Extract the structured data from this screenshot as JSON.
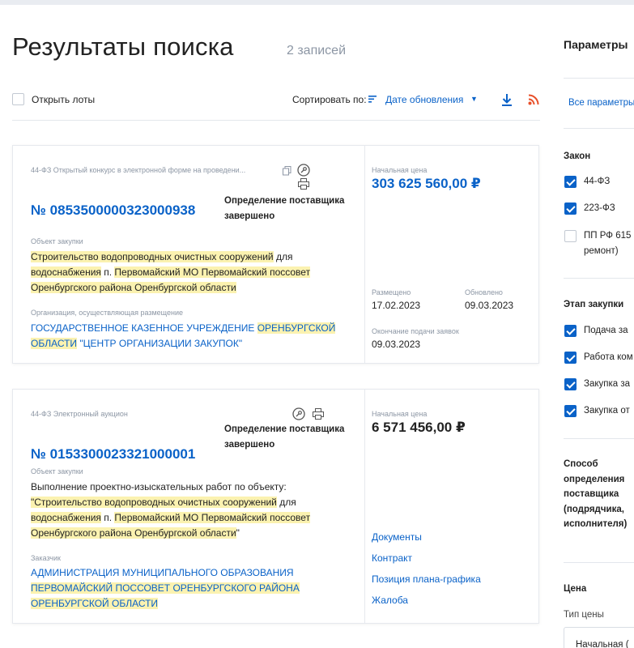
{
  "page": {
    "title": "Результаты поиска",
    "count": "2 записей"
  },
  "toolbar": {
    "open_lots_label": "Открыть лоты",
    "sort_label": "Сортировать по:",
    "sort_value": "Дате обновления",
    "icons": [
      "sort-lines-icon",
      "chevron-down-icon",
      "download-icon",
      "rss-icon"
    ]
  },
  "results": [
    {
      "law": "44-ФЗ Открытый конкурс в электронной форме на проведени...",
      "reg_number": "№ 0853500000323000938",
      "status": "Определение поставщика завершено",
      "object_label": "Объект закупки",
      "object_text": [
        {
          "t": "Строительство водопроводных очистных сооружений",
          "hl": true
        },
        {
          "t": " для ",
          "hl": false
        },
        {
          "t": "водоснабжения",
          "hl": true
        },
        {
          "t": " п. ",
          "hl": false
        },
        {
          "t": "Первомайский МО Первомайский поссовет Оренбургского района Оренбургской области",
          "hl": true
        }
      ],
      "org_label": "Организация, осуществляющая размещение",
      "org_text": [
        {
          "t": "ГОСУДАРСТВЕННОЕ КАЗЕННОЕ УЧРЕЖДЕНИЕ ",
          "hl": false
        },
        {
          "t": "ОРЕНБУРГСКОЙ ОБЛАСТИ",
          "hl": true
        },
        {
          "t": " \"ЦЕНТР ОРГАНИЗАЦИИ ЗАКУПОК\"",
          "hl": false
        }
      ],
      "price_label": "Начальная цена",
      "price": "303 625 560,00 ₽",
      "placed_label": "Размещено",
      "placed": "17.02.2023",
      "updated_label": "Обновлено",
      "updated": "09.03.2023",
      "deadline_label": "Окончание подачи заявок",
      "deadline": "09.03.2023"
    },
    {
      "law": "44-ФЗ Электронный аукцион",
      "reg_number": "№ 0153300023321000001",
      "status": "Определение поставщика завершено",
      "object_label": "Объект закупки",
      "object_text": [
        {
          "t": "Выполнение проектно-изыскательных работ по объекту: ",
          "hl": false
        },
        {
          "t": "\"Строительство водопроводных очистных сооружений",
          "hl": true
        },
        {
          "t": " для ",
          "hl": false
        },
        {
          "t": "водоснабжения",
          "hl": true
        },
        {
          "t": " п. ",
          "hl": false
        },
        {
          "t": "Первомайский МО Первомайский поссовет Оренбургского района Оренбургской области",
          "hl": true
        },
        {
          "t": "\"",
          "hl": false
        }
      ],
      "org_label": "Заказчик",
      "org_text": [
        {
          "t": "АДМИНИСТРАЦИЯ МУНИЦИПАЛЬНОГО ОБРАЗОВАНИЯ ",
          "hl": false
        },
        {
          "t": "ПЕРВОМАЙСКИЙ ПОССОВЕТ ОРЕНБУРГСКОГО РАЙОНА ОРЕНБУРГСКОЙ ОБЛАСТИ",
          "hl": true
        }
      ],
      "price_label": "Начальная цена",
      "price": "6 571 456,00 ₽",
      "links": [
        "Документы",
        "Контракт",
        "Позиция плана-графика",
        "Жалоба"
      ]
    }
  ],
  "sidebar": {
    "title": "Параметры",
    "all_params": "Все параметры",
    "law_title": "Закон",
    "law_items": [
      {
        "label": "44-ФЗ",
        "checked": true
      },
      {
        "label": "223-ФЗ",
        "checked": true
      },
      {
        "label": "ПП РФ 615",
        "label2": "ремонт)",
        "checked": false
      }
    ],
    "stage_title": "Этап закупки",
    "stage_items": [
      {
        "label": "Подача за",
        "checked": true
      },
      {
        "label": "Работа ком",
        "checked": true
      },
      {
        "label": "Закупка за",
        "checked": true
      },
      {
        "label": "Закупка от",
        "checked": true
      }
    ],
    "method_title_lines": [
      "Способ",
      "определения",
      "поставщика",
      "(подрядчика,",
      "исполнителя)"
    ],
    "price_title": "Цена",
    "price_type_label": "Тип цены",
    "price_type_value": "Начальная (",
    "colors": {
      "accent": "#0a62c8",
      "highlight": "#fbf2b0",
      "rss": "#e8502a"
    }
  }
}
